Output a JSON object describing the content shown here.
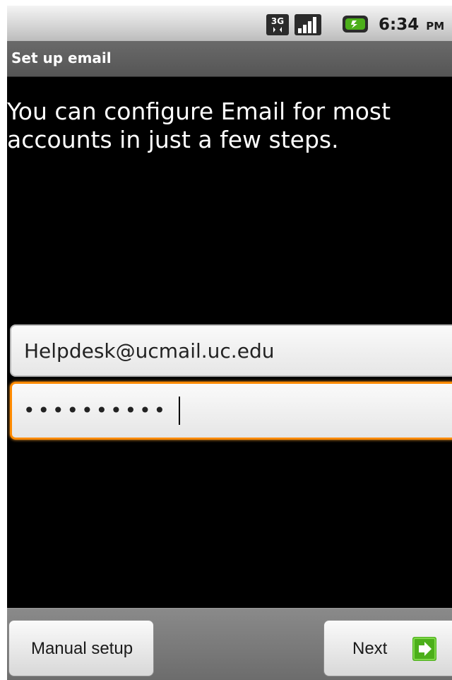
{
  "status_bar": {
    "network_badge": "3G",
    "time": "6:34",
    "ampm": "PM",
    "icons": [
      "network-3g-icon",
      "signal-strength-icon",
      "battery-icon"
    ]
  },
  "title_bar": {
    "title": "Set up email"
  },
  "intro": {
    "text": "You can configure Email for most accounts in just a few steps."
  },
  "form": {
    "email_value": "Helpdesk@ucmail.uc.edu",
    "password_mask": "••••••••••"
  },
  "buttons": {
    "manual_setup": "Manual setup",
    "next": "Next"
  },
  "colors": {
    "focus_border": "#ff8a00",
    "next_icon": "#4caf1a",
    "background": "#000000"
  }
}
